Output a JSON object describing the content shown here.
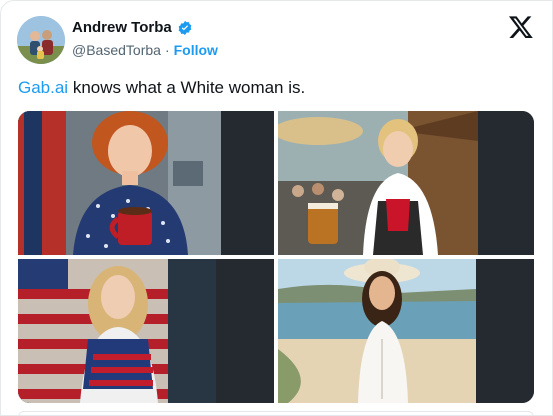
{
  "tweet": {
    "author_name": "Andrew Torba",
    "author_handle": "@BasedTorba",
    "separator": "·",
    "follow_label": "Follow",
    "text_link": "Gab.ai",
    "text_rest": " knows what a White woman is."
  },
  "icons": {
    "verified": "verified-badge-icon",
    "platform": "x-logo-icon"
  },
  "colors": {
    "accent": "#1d9bf0",
    "text": "#0f1419",
    "muted": "#536471"
  },
  "media": {
    "image_count": 4
  }
}
